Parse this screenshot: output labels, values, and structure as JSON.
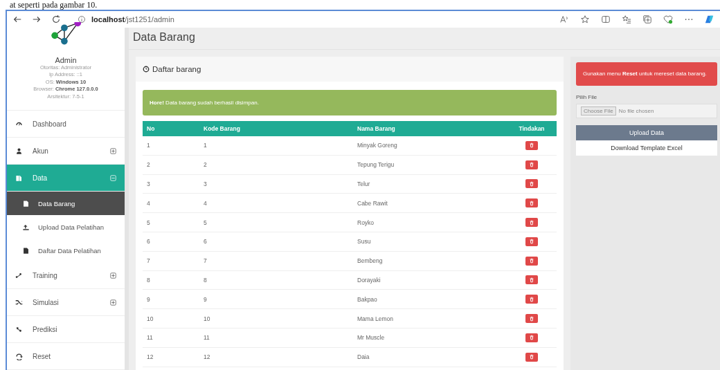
{
  "caption": "at seperti pada gambar 10.",
  "browser": {
    "url_host": "localhost",
    "url_path": "/jst1251/admin"
  },
  "page_title": "Data Barang",
  "profile": {
    "name": "Admin",
    "lines": [
      {
        "label": "Otoritas: ",
        "value": "Administrator",
        "bold": false
      },
      {
        "label": "Ip Address: ",
        "value": "::1",
        "bold": false
      },
      {
        "label": "OS: ",
        "value": "Windows 10",
        "bold": true
      },
      {
        "label": "Browser: ",
        "value": "Chrome 127.0.0.0",
        "bold": true
      },
      {
        "label": "Arsitektur: ",
        "value": "7-5-1",
        "bold": false
      }
    ]
  },
  "sidebar": {
    "items": [
      {
        "label": "Dashboard",
        "selected": false
      },
      {
        "label": "Akun",
        "selected": false,
        "expanded": false
      },
      {
        "label": "Data",
        "selected": true,
        "expanded": true,
        "children": [
          {
            "label": "Data Barang",
            "selected": true
          },
          {
            "label": "Upload Data Pelatihan",
            "selected": false
          },
          {
            "label": "Daftar Data Pelatihan",
            "selected": false
          }
        ]
      },
      {
        "label": "Training",
        "selected": false,
        "expanded": false
      },
      {
        "label": "Simulasi",
        "selected": false,
        "expanded": false
      },
      {
        "label": "Prediksi",
        "selected": false
      },
      {
        "label": "Reset",
        "selected": false
      }
    ]
  },
  "card": {
    "title": "Daftar barang",
    "alert": "**Hore!** Data barang sudah berhasil disimpan.",
    "table": {
      "columns": [
        "No",
        "Kode Barang",
        "Nama Barang",
        "Tindakan"
      ],
      "rows": [
        [
          "1",
          "1",
          "Minyak Goreng"
        ],
        [
          "2",
          "2",
          "Tepung Terigu"
        ],
        [
          "3",
          "3",
          "Telur"
        ],
        [
          "4",
          "4",
          "Cabe Rawit"
        ],
        [
          "5",
          "5",
          "Royko"
        ],
        [
          "6",
          "6",
          "Susu"
        ],
        [
          "7",
          "7",
          "Bembeng"
        ],
        [
          "8",
          "8",
          "Dorayaki"
        ],
        [
          "9",
          "9",
          "Bakpao"
        ],
        [
          "10",
          "10",
          "Mama Lemon"
        ],
        [
          "11",
          "11",
          "Mr Muscle"
        ],
        [
          "12",
          "12",
          "Daia"
        ]
      ]
    }
  },
  "side_panel": {
    "notice": "Gunakan menu **Reset** untuk mereset data barang.",
    "file_label": "Pilih File",
    "file_button": "Choose File",
    "file_status": "No file chosen",
    "upload_button": "Upload Data",
    "download_button": "Download Template Excel"
  }
}
